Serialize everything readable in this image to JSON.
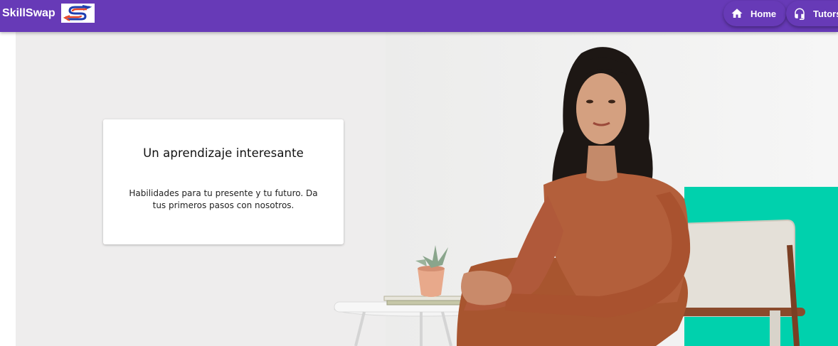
{
  "app": {
    "brand": "SkillSwap",
    "logo_icon": "skillswap-logo-icon"
  },
  "nav": {
    "home_label": "Home",
    "home_icon": "home-icon",
    "tutors_label": "Tutors",
    "tutors_icon": "headset-icon"
  },
  "hero": {
    "title": "Un aprendizaje interesante",
    "description": "Habilidades para tu presente y tu futuro. Da tus primeros pasos con nosotros."
  },
  "colors": {
    "appbar": "#673ab7",
    "hero_bg": "#eeeded",
    "accent_block": "#00d1ad",
    "dress": "#b35f3b"
  }
}
